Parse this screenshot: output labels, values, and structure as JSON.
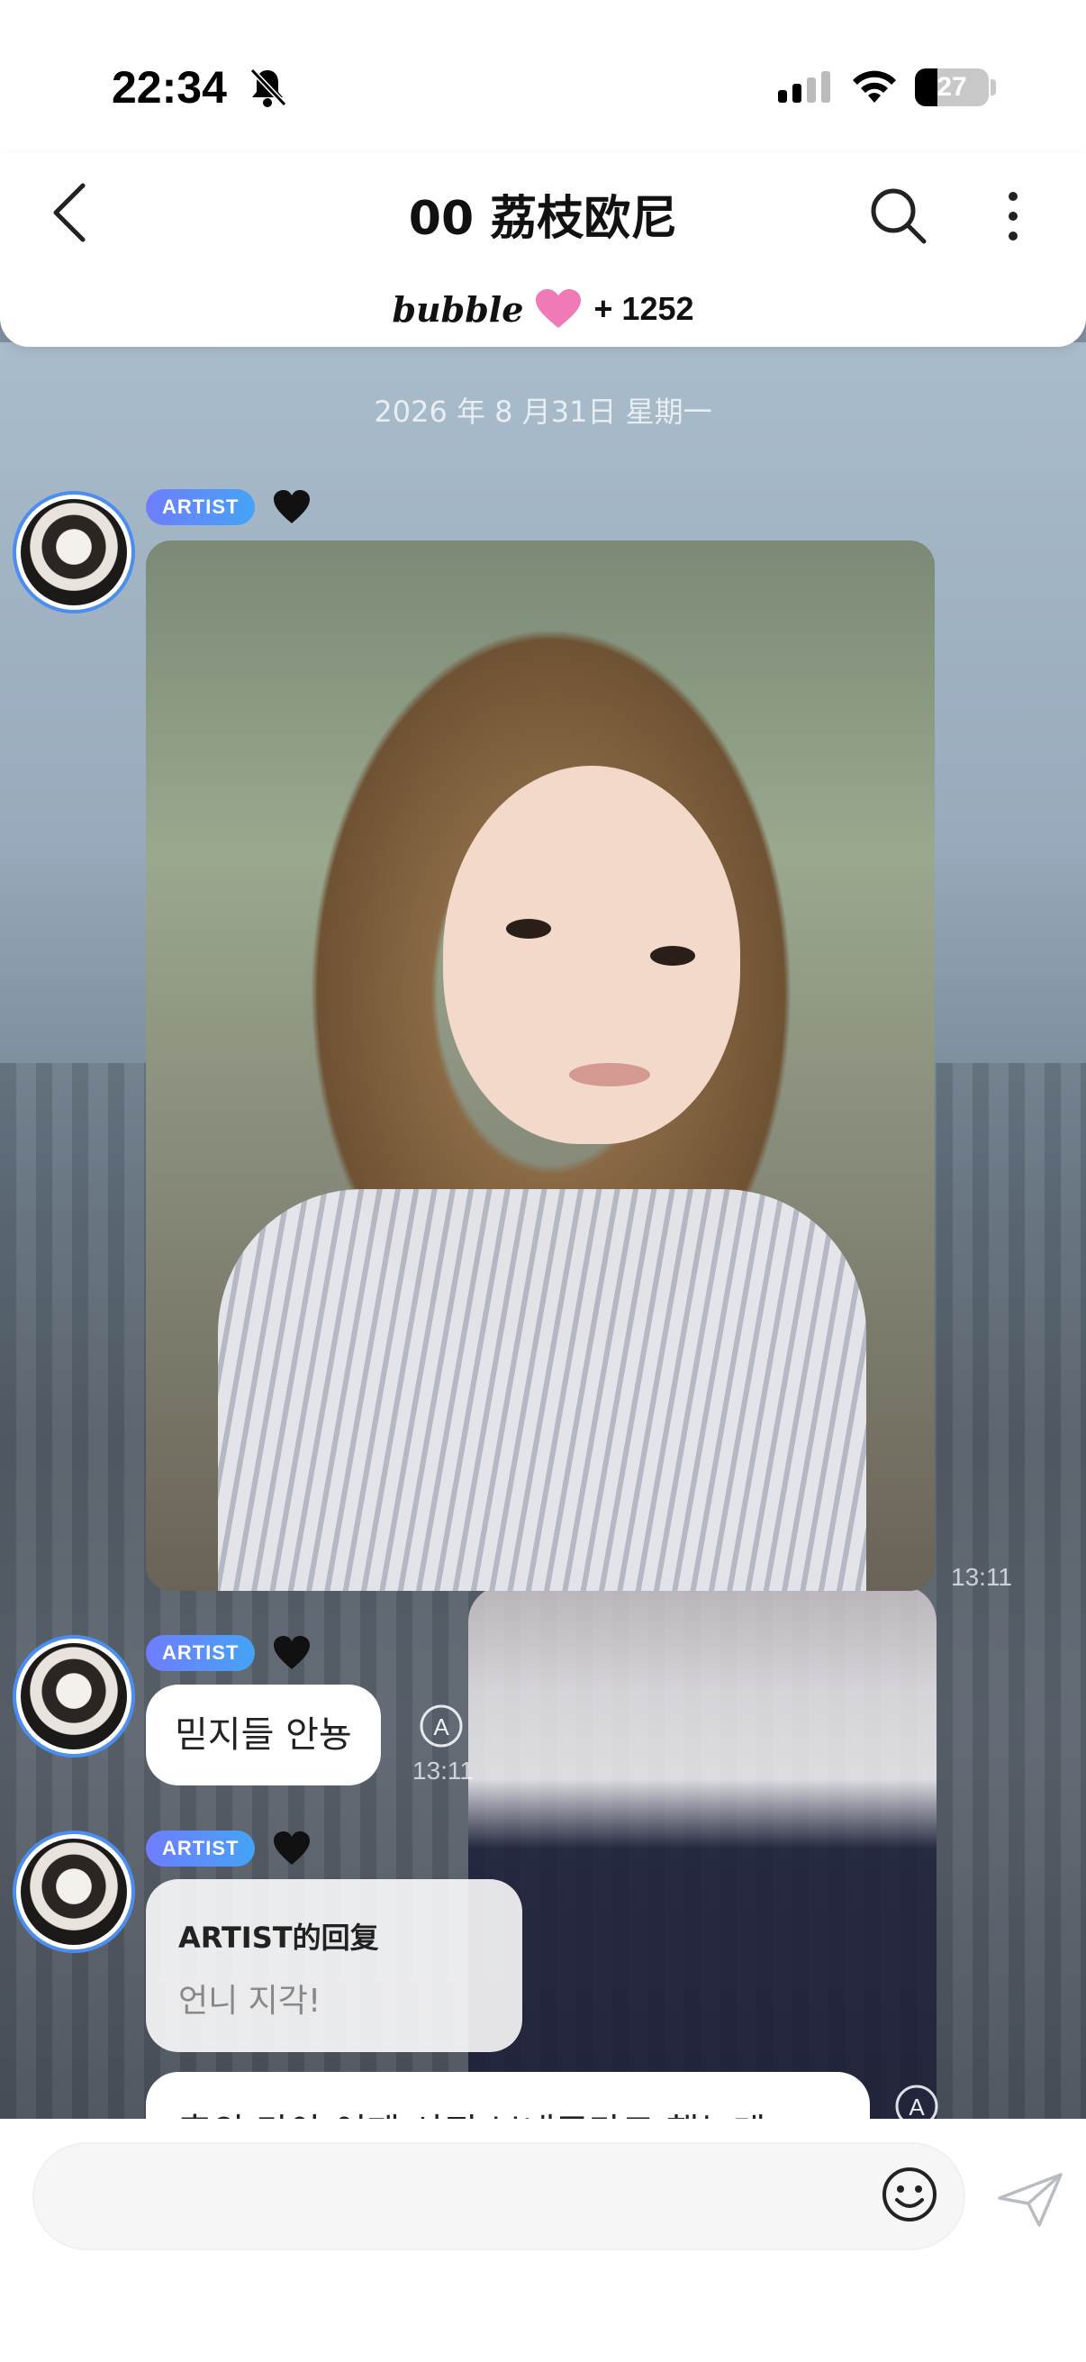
{
  "status_bar": {
    "time": "22:34",
    "battery": "27",
    "icons": [
      "bell-muted-icon",
      "cellular-signal-icon",
      "wifi-icon",
      "battery-icon"
    ]
  },
  "header": {
    "title": "00 荔枝欧尼",
    "brand": "bubble",
    "count": "+ 1252",
    "icons": [
      "back-arrow-icon",
      "search-icon",
      "more-vertical-icon",
      "pink-heart-icon"
    ]
  },
  "chat": {
    "date": "2026 年 8 月31日 星期一",
    "messages": [
      {
        "badge": "ARTIST",
        "type": "image",
        "time": "13:11"
      },
      {
        "badge": "ARTIST",
        "type": "text",
        "text": "믿지들 안뇽",
        "time": "13:11"
      },
      {
        "badge": "ARTIST",
        "type": "reply",
        "reply_title": "ARTIST的回复",
        "reply_text": "언니 지각!"
      },
      {
        "type": "text",
        "text": "혼의 만아 어제 사진 보내주다고 했는데"
      }
    ]
  },
  "composer": {
    "placeholder": "",
    "icons": [
      "emoji-icon",
      "send-icon"
    ]
  },
  "colors": {
    "badge_gradient_start": "#6f7dff",
    "badge_gradient_end": "#45a3f5",
    "avatar_ring": "#4c8ef0",
    "heart_pink": "#f07ab5"
  }
}
